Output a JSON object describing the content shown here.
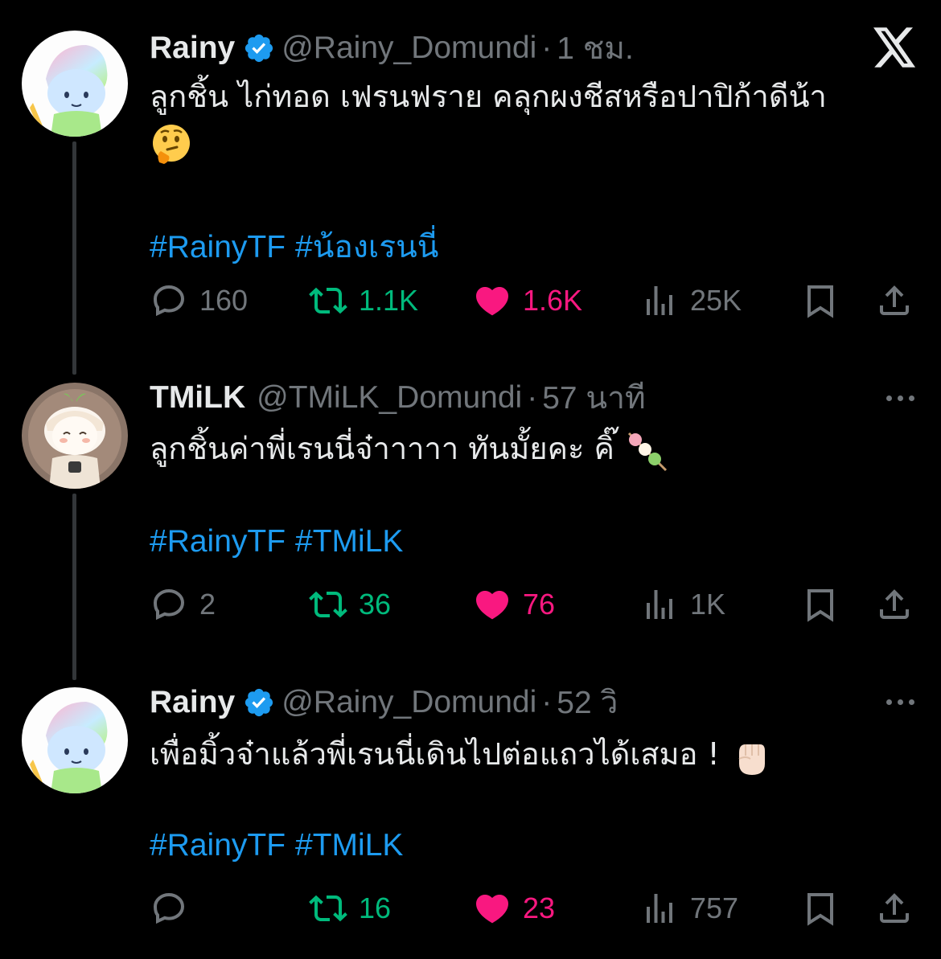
{
  "tweets": [
    {
      "name": "Rainy",
      "verified": true,
      "handle": "@Rainy_Domundi",
      "time": "1 ชม.",
      "text_line1": "ลูกชิ้น ไก่ทอด เฟรนฟราย คลุกผงชีสหรือปาปิก้าดีน้า",
      "text_emoji": "thinking-face",
      "hashtags": [
        "#RainyTF",
        "#น้องเรนนี่"
      ],
      "replies": "160",
      "retweets": "1.1K",
      "likes": "1.6K",
      "views": "25K"
    },
    {
      "name": "TMiLK",
      "verified": false,
      "handle": "@TMiLK_Domundi",
      "time": "57 นาที",
      "text_line1": "ลูกชิ้นค่าพี่เรนนี่จ๋าาาาา ทันมั้ยคะ คิ๊",
      "text_emoji": "dango",
      "hashtags": [
        "#RainyTF",
        "#TMiLK"
      ],
      "replies": "2",
      "retweets": "36",
      "likes": "76",
      "views": "1K"
    },
    {
      "name": "Rainy",
      "verified": true,
      "handle": "@Rainy_Domundi",
      "time": "52 วิ",
      "text_line1": "เพื่อมิ้วจ๋าแล้วพี่เรนนี่เดินไปต่อแถวได้เสมอ !",
      "text_emoji": "raised-fist",
      "hashtags": [
        "#RainyTF",
        "#TMiLK"
      ],
      "replies": "",
      "retweets": "16",
      "likes": "23",
      "views": "757"
    }
  ],
  "colors": {
    "accent": "#1d9bf0",
    "retweet": "#00ba7c",
    "like": "#f91880",
    "muted": "#71767b"
  },
  "icons": [
    "x-logo-icon",
    "more-icon",
    "reply-icon",
    "retweet-icon",
    "like-icon",
    "views-icon",
    "bookmark-icon",
    "share-icon"
  ]
}
